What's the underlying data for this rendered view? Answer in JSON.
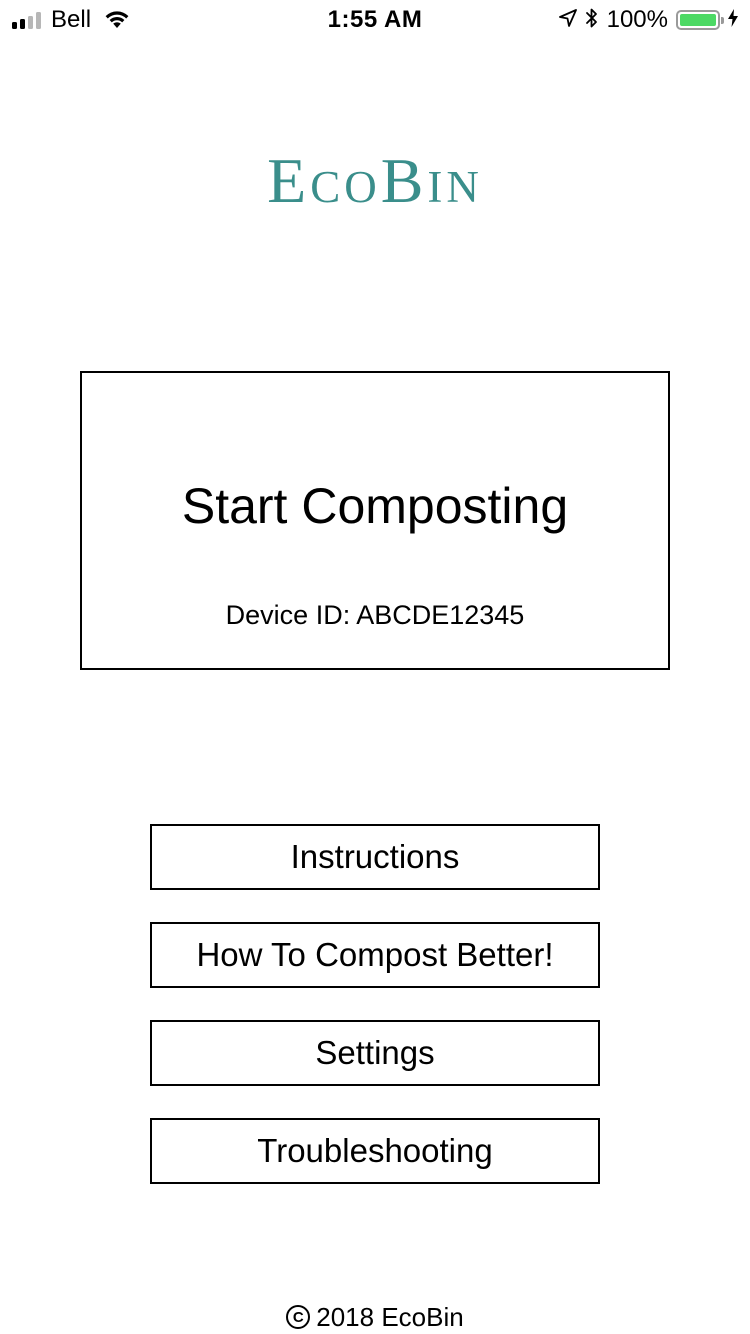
{
  "status_bar": {
    "carrier": "Bell",
    "time": "1:55 AM",
    "battery_percent": "100%",
    "battery_level": 1.0,
    "signal_bars_filled": 2,
    "signal_bars_total": 4,
    "icons": [
      "signal-icon",
      "wifi-icon",
      "location-arrow-icon",
      "bluetooth-icon",
      "battery-icon",
      "charging-bolt-icon"
    ],
    "battery_color": "#4cd964"
  },
  "app": {
    "logo_text": "EcoBin",
    "brand_color": "#3a8e8b"
  },
  "start_panel": {
    "title": "Start Composting",
    "device_id": "Device ID: ABCDE12345"
  },
  "menu": {
    "items": [
      {
        "label": "Instructions"
      },
      {
        "label": "How To Compost Better!"
      },
      {
        "label": "Settings"
      },
      {
        "label": "Troubleshooting"
      }
    ]
  },
  "footer": {
    "copyright_symbol": "C",
    "text": "2018 EcoBin"
  }
}
